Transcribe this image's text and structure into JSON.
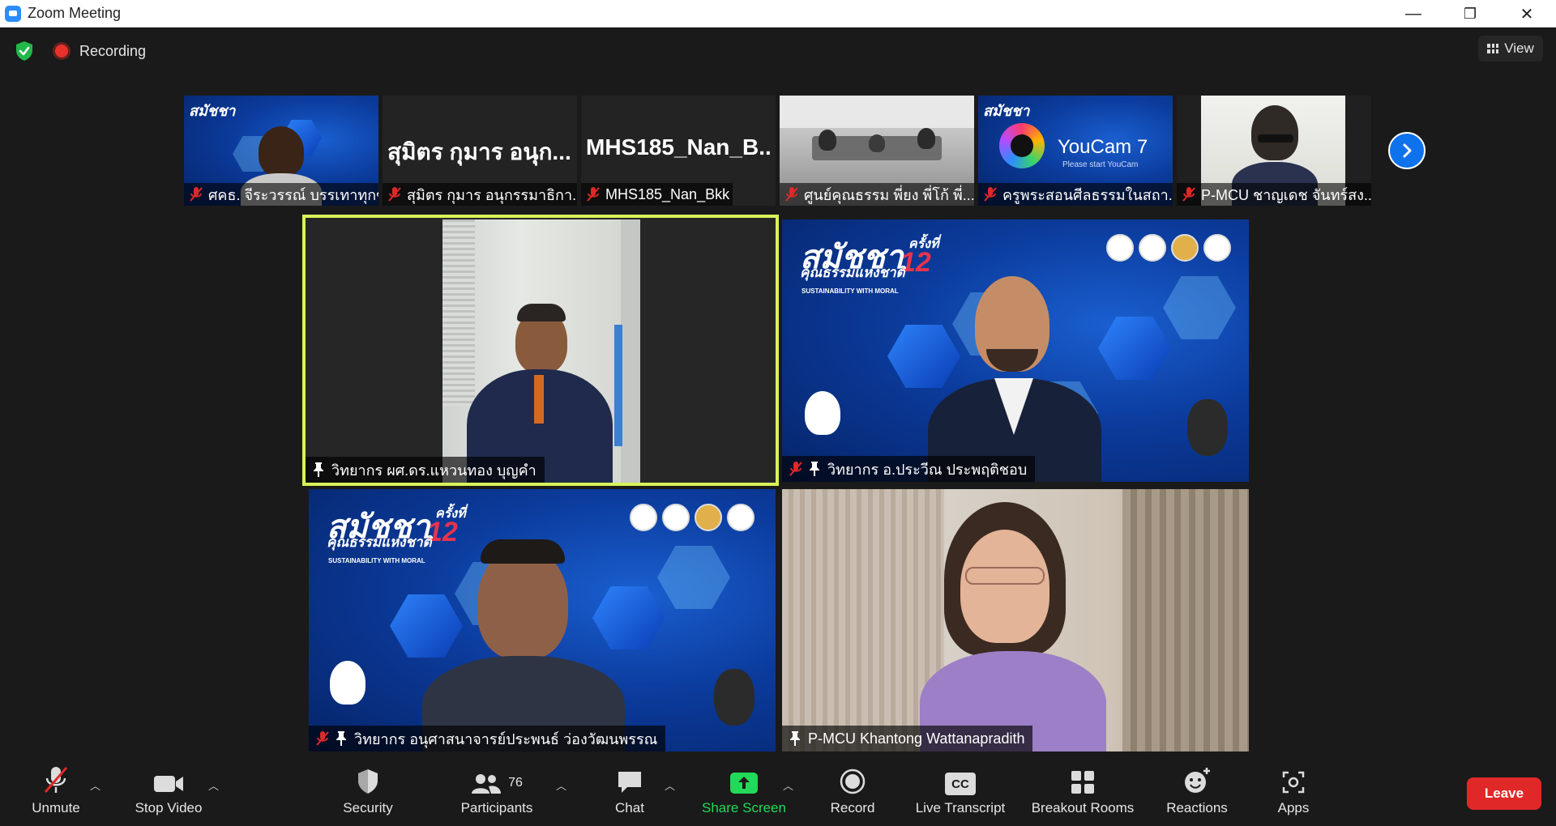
{
  "window": {
    "title": "Zoom Meeting",
    "minimize": "—",
    "restore": "❐",
    "close": "✕"
  },
  "topbar": {
    "recording_label": "Recording",
    "view_label": "View"
  },
  "strip": [
    {
      "name": "ศคธ. จีระวรรณ์ บรรเทาทุกข์",
      "muted": true
    },
    {
      "name": "สุมิตร กุมาร อนุกรรมาธิกา...",
      "big_name": "สุมิตร กุมาร อนุก...",
      "muted": true
    },
    {
      "name": "MHS185_Nan_Bkk",
      "big_name": "MHS185_Nan_B...",
      "muted": true
    },
    {
      "name": "ศูนย์คุณธรรม พี่ยง พี่โก้ พี่...",
      "muted": true
    },
    {
      "name": "ครูพระสอนศีลธรรมในสถา...",
      "muted": true,
      "overlay_text": "YouCam 7",
      "overlay_sub": "Please start YouCam"
    },
    {
      "name": "P-MCU ชาญเดช จันทร์สง...",
      "muted": true
    }
  ],
  "gallery": [
    {
      "name": "วิทยากร ผศ.ดร.แหวนทอง บุญคำ",
      "muted": false,
      "pinned": true,
      "active": true
    },
    {
      "name": "วิทยากร อ.ประวีณ ประพฤติชอบ",
      "muted": true,
      "pinned": true,
      "active": false
    },
    {
      "name": "วิทยากร อนุศาสนาจารย์ประพนธ์ ว่องวัฒนพรรณ",
      "muted": true,
      "pinned": true,
      "active": false
    },
    {
      "name": "P-MCU Khantong Wattanapradith",
      "muted": false,
      "pinned": true,
      "active": false
    }
  ],
  "banner": {
    "title": "สมัชชา",
    "subtitle": "คุณธรรมแห่งชาติ",
    "round": "ครั้งที่",
    "number": "12",
    "tagline": "SUSTAINABILITY WITH MORAL"
  },
  "toolbar": {
    "unmute": "Unmute",
    "stop_video": "Stop Video",
    "security": "Security",
    "participants": "Participants",
    "participants_count": "76",
    "chat": "Chat",
    "share_screen": "Share Screen",
    "record": "Record",
    "live_transcript": "Live Transcript",
    "breakout_rooms": "Breakout Rooms",
    "reactions": "Reactions",
    "apps": "Apps",
    "leave": "Leave",
    "cc_badge": "CC"
  },
  "colors": {
    "accent": "#0e72ed",
    "active_speaker": "#d8f25a",
    "leave": "#e02828",
    "share": "#23d959",
    "recording": "#e8312c"
  }
}
